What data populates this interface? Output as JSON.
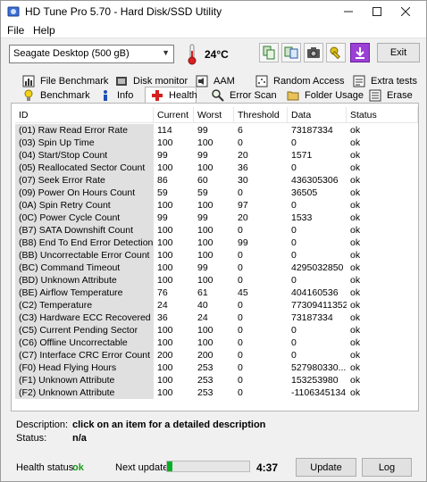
{
  "window": {
    "title": "HD Tune Pro 5.70 - Hard Disk/SSD Utility"
  },
  "menu": {
    "file": "File",
    "help": "Help"
  },
  "toolbar": {
    "drive": "Seagate Desktop (500 gB)",
    "temperature": "24°C",
    "exit_label": "Exit"
  },
  "tabs": {
    "row1": [
      "File Benchmark",
      "Disk monitor",
      "AAM",
      "Random Access",
      "Extra tests"
    ],
    "row2": [
      "Benchmark",
      "Info",
      "Health",
      "Error Scan",
      "Folder Usage",
      "Erase"
    ],
    "active": "Health"
  },
  "health": {
    "columns": [
      "ID",
      "Current",
      "Worst",
      "Threshold",
      "Data",
      "Status"
    ],
    "rows": [
      [
        "(01) Raw Read Error Rate",
        "114",
        "99",
        "6",
        "73187334",
        "ok"
      ],
      [
        "(03) Spin Up Time",
        "100",
        "100",
        "0",
        "0",
        "ok"
      ],
      [
        "(04) Start/Stop Count",
        "99",
        "99",
        "20",
        "1571",
        "ok"
      ],
      [
        "(05) Reallocated Sector Count",
        "100",
        "100",
        "36",
        "0",
        "ok"
      ],
      [
        "(07) Seek Error Rate",
        "86",
        "60",
        "30",
        "436305306",
        "ok"
      ],
      [
        "(09) Power On Hours Count",
        "59",
        "59",
        "0",
        "36505",
        "ok"
      ],
      [
        "(0A) Spin Retry Count",
        "100",
        "100",
        "97",
        "0",
        "ok"
      ],
      [
        "(0C) Power Cycle Count",
        "99",
        "99",
        "20",
        "1533",
        "ok"
      ],
      [
        "(B7) SATA Downshift Count",
        "100",
        "100",
        "0",
        "0",
        "ok"
      ],
      [
        "(B8) End To End Error Detection",
        "100",
        "100",
        "99",
        "0",
        "ok"
      ],
      [
        "(BB) Uncorrectable Error Count",
        "100",
        "100",
        "0",
        "0",
        "ok"
      ],
      [
        "(BC) Command Timeout",
        "100",
        "99",
        "0",
        "4295032850",
        "ok"
      ],
      [
        "(BD) Unknown Attribute",
        "100",
        "100",
        "0",
        "0",
        "ok"
      ],
      [
        "(BE) Airflow Temperature",
        "76",
        "61",
        "45",
        "404160536",
        "ok"
      ],
      [
        "(C2) Temperature",
        "24",
        "40",
        "0",
        "77309411352",
        "ok"
      ],
      [
        "(C3) Hardware ECC Recovered",
        "36",
        "24",
        "0",
        "73187334",
        "ok"
      ],
      [
        "(C5) Current Pending Sector",
        "100",
        "100",
        "0",
        "0",
        "ok"
      ],
      [
        "(C6) Offline Uncorrectable",
        "100",
        "100",
        "0",
        "0",
        "ok"
      ],
      [
        "(C7) Interface CRC Error Count",
        "200",
        "200",
        "0",
        "0",
        "ok"
      ],
      [
        "(F0) Head Flying Hours",
        "100",
        "253",
        "0",
        "527980330...",
        "ok"
      ],
      [
        "(F1) Unknown Attribute",
        "100",
        "253",
        "0",
        "153253980",
        "ok"
      ],
      [
        "(F2) Unknown Attribute",
        "100",
        "253",
        "0",
        "-1106345134",
        "ok"
      ]
    ]
  },
  "description": {
    "desc_label": "Description:",
    "desc_value": "click on an item for a detailed description",
    "status_label": "Status:",
    "status_value": "n/a"
  },
  "footer": {
    "health_label": "Health status:",
    "health_value": "ok",
    "next_update_label": "Next update:",
    "countdown": "4:37",
    "progress_fraction": 0.07,
    "update_label": "Update",
    "log_label": "Log"
  },
  "colors": {
    "id_column_bg": "#e0e0e0",
    "ok_green": "#1a9e1a",
    "progress_green": "#06b025"
  }
}
